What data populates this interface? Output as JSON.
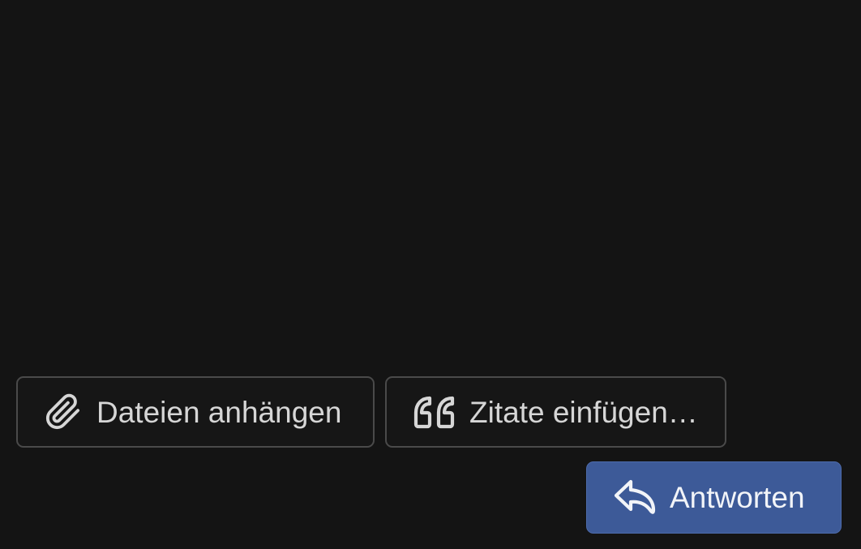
{
  "toolbar": {
    "attach": {
      "label": "Dateien anhängen",
      "icon": "paperclip-icon"
    },
    "quote": {
      "label": "Zitate einfügen…",
      "icon": "quote-icon"
    }
  },
  "actions": {
    "reply": {
      "label": "Antworten",
      "icon": "reply-arrow-icon"
    }
  },
  "colors": {
    "background": "#141414",
    "outline_button_border": "#4a4a4a",
    "outline_button_text": "#d6d6d6",
    "primary_button": "#3d5a98",
    "primary_button_text": "#f2f4f8"
  }
}
